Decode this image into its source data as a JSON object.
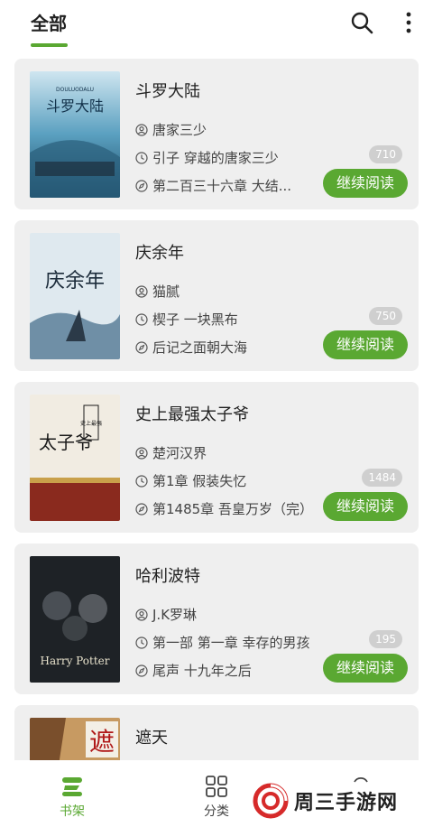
{
  "header": {
    "tab_label": "全部",
    "accent": "#5aa832"
  },
  "icons": {
    "search": "search-icon",
    "more": "more-vertical-icon",
    "author": "person-circle-icon",
    "chapter": "clock-icon",
    "last": "compass-icon"
  },
  "books": [
    {
      "title": "斗罗大陆",
      "author": "唐家三少",
      "current_chapter": "引子 穿越的唐家三少",
      "latest_chapter": "第二百三十六章 大结...",
      "count": "710",
      "button": "继续阅读",
      "cover": {
        "lines": [
          "斗罗大陆",
          "DOULUODALU"
        ]
      }
    },
    {
      "title": "庆余年",
      "author": "猫腻",
      "current_chapter": "楔子 一块黑布",
      "latest_chapter": "后记之面朝大海",
      "count": "750",
      "button": "继续阅读",
      "cover": {
        "lines": [
          "庆余年"
        ]
      }
    },
    {
      "title": "史上最强太子爷",
      "author": "楚河汉界",
      "current_chapter": "第1章 假装失忆",
      "latest_chapter": "第1485章 吾皇万岁（完）",
      "count": "1484",
      "button": "继续阅读",
      "cover": {
        "lines": [
          "太子爷",
          "史上最强"
        ]
      }
    },
    {
      "title": "哈利波特",
      "author": "J.K罗琳",
      "current_chapter": "第一部 第一章 幸存的男孩",
      "latest_chapter": "尾声 十九年之后",
      "count": "195",
      "button": "继续阅读",
      "cover": {
        "lines": [
          "Harry Potter"
        ]
      }
    },
    {
      "title": "遮天",
      "cover": {
        "lines": [
          "遮"
        ]
      }
    }
  ],
  "bottom_nav": {
    "shelf": "书架",
    "category": "分类"
  },
  "watermark": {
    "text": "周三手游网"
  }
}
